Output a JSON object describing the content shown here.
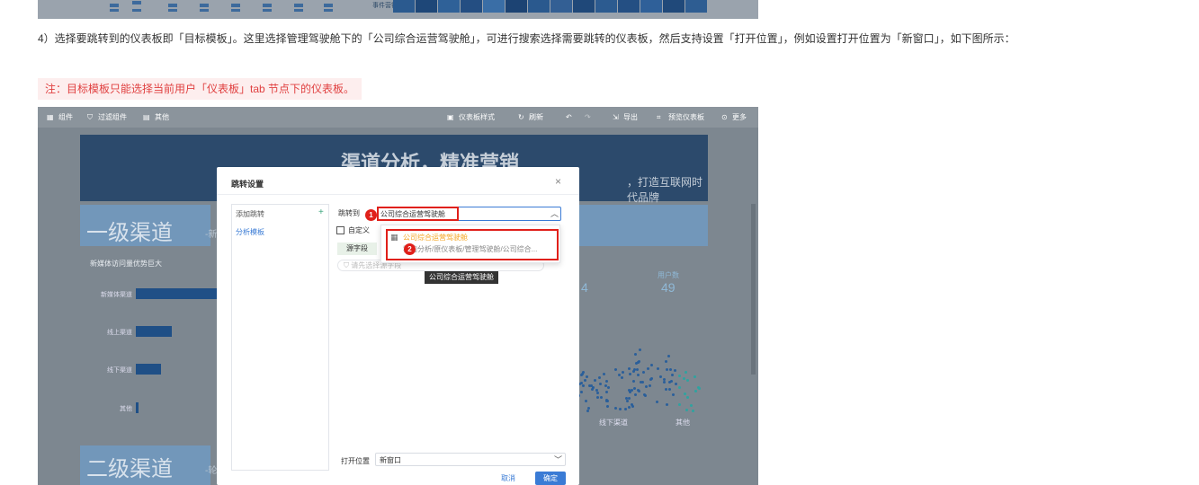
{
  "top_strip": {
    "label": "事件营销"
  },
  "paragraph": "4）选择要跳转到的仪表板即「目标模板」。这里选择管理驾驶舱下的「公司综合运营驾驶舱」，可进行搜索选择需要跳转的仪表板，然后支持设置「打开位置」，例如设置打开位置为「新窗口」，如下图所示：",
  "note": "注：目标模板只能选择当前用户「仪表板」tab 节点下的仪表板。",
  "toolbar": {
    "component": "组件",
    "filter": "过滤组件",
    "other": "其他",
    "style": "仪表板样式",
    "refresh": "刷新",
    "export": "导出",
    "preview": "预览仪表板",
    "more": "更多"
  },
  "banner": {
    "title": "渠道分析，精准营销",
    "subtitle": "，打造互联网时代品牌"
  },
  "level1": {
    "title": "一级渠道",
    "suffix": "-新"
  },
  "level2": {
    "title": "二级渠道",
    "suffix": "-轮"
  },
  "chart": {
    "title": "新媒体访问量优势巨大",
    "categories": [
      "新媒体渠道",
      "线上渠道",
      "线下渠道",
      "其他"
    ],
    "values": [
      95,
      40,
      28,
      3
    ],
    "x_labels": [
      "线下渠道",
      "其他"
    ],
    "kpi_label": "用户数",
    "kpi_value": "49",
    "kpi_value2": "4"
  },
  "dialog": {
    "title": "跳转设置",
    "add_jump": "添加跳转",
    "template_item": "分析模板",
    "jump_to_label": "跳转到",
    "jump_to_value": "公司综合运营驾驶舱",
    "dropdown_name": "公司综合运营驾驶舱",
    "dropdown_path": "我的分析/原仪表板/管理驾驶舱/公司综合...",
    "custom_label": "自定义",
    "source_field": "源字段",
    "source_placeholder": "请先选择源字段",
    "tooltip": "公司综合运营驾驶舱",
    "open_pos_label": "打开位置",
    "open_pos_value": "新窗口",
    "cancel": "取消",
    "confirm": "确定",
    "badge1": "1",
    "badge2": "2"
  }
}
